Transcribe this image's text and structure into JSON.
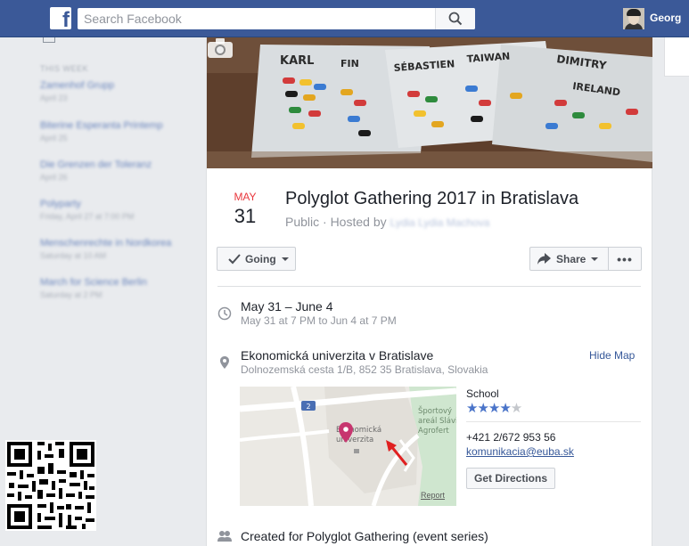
{
  "topbar": {
    "logo": "f",
    "search_placeholder": "Search Facebook",
    "username": "Georg"
  },
  "sidebar": {
    "header": "THIS WEEK",
    "items": [
      {
        "title": "Zamenhof Grupp",
        "sub": "April 23"
      },
      {
        "title": "Biterine Esperanta Printemp",
        "sub": "April 25"
      },
      {
        "title": "Die Grenzen der Toleranz",
        "sub": "April 26"
      },
      {
        "title": "Polyparty",
        "sub": "Friday, April 27 at 7:00 PM"
      },
      {
        "title": "Menschenrechte in Nordkorea",
        "sub": "Saturday at 10 AM"
      },
      {
        "title": "March for Science Berlin",
        "sub": "Saturday at 2 PM"
      }
    ]
  },
  "event": {
    "month": "MAY",
    "day": "31",
    "title": "Polyglot Gathering 2017 in Bratislava",
    "subtitle": "Public · Hosted by",
    "host": "Lydia Lydia Machova",
    "going_label": "Going",
    "share_label": "Share",
    "more_label": "•••",
    "date_main": "May 31 – June 4",
    "date_sub": "May 31 at 7 PM to Jun 4 at 7 PM",
    "location_main": "Ekonomická univerzita v Bratislave",
    "location_sub": "Dolnozemská cesta 1/B, 852 35 Bratislava, Slovakia",
    "hide_map": "Hide Map",
    "created_for": "Created for Polyglot Gathering (event series)"
  },
  "map": {
    "road_label": "2",
    "place_label": "Ekonomická univerzita",
    "park_label": "Športový areál Slávi Agrofert",
    "report": "Report",
    "pin_color": "#c7366f",
    "arrow_color": "#e02020"
  },
  "place_info": {
    "type": "School",
    "rating": 4,
    "max_rating": 5,
    "stars_filled": "★★★★",
    "stars_empty": "★",
    "phone": "+421 2/672 953 56",
    "email": "komunikacia@euba.sk",
    "directions_label": "Get Directions"
  },
  "cover": {
    "board_labels": [
      "KARL",
      "FIN",
      "SÉBASTIEN",
      "TAIWAN",
      "DIMITRY",
      "IRELAND"
    ]
  },
  "colors": {
    "brand": "#3b5998",
    "link": "#365899",
    "date_month": "#e9373d"
  }
}
